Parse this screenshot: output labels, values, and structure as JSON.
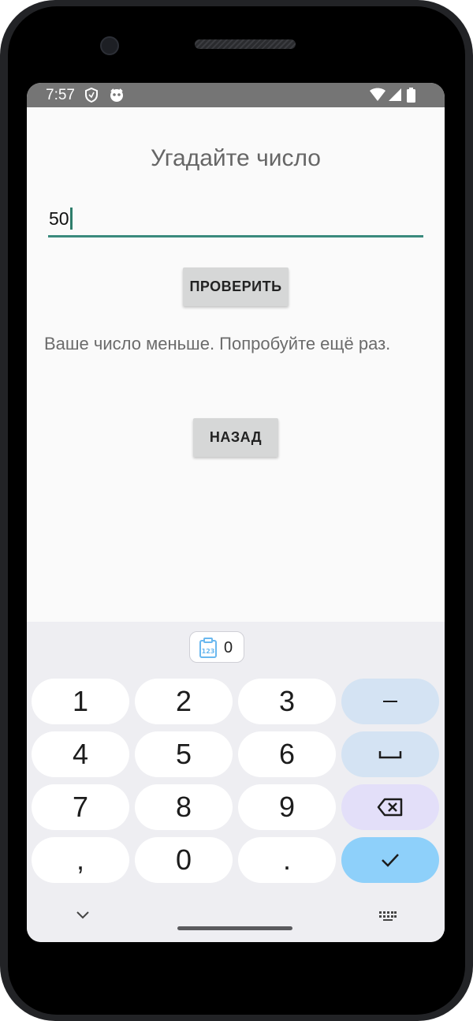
{
  "status_bar": {
    "time": "7:57",
    "icons": [
      "shield-icon",
      "assistant-icon",
      "wifi-icon",
      "signal-icon",
      "battery-icon"
    ]
  },
  "app": {
    "title": "Угадайте число",
    "input_value": "50",
    "check_button_label": "ПРОВЕРИТЬ",
    "message": "Ваше число меньше. Попробуйте ещё раз.",
    "back_button_label": "НАЗАД"
  },
  "keyboard": {
    "clipboard_chip": {
      "icon": "clipboard-numbers-icon",
      "label": "0"
    },
    "digit_keys": [
      "1",
      "2",
      "3",
      "4",
      "5",
      "6",
      "7",
      "8",
      "9",
      ",",
      "0",
      "."
    ],
    "side_keys": [
      "minus",
      "space",
      "backspace",
      "done"
    ],
    "bottom_icons": [
      "chevron-down-icon",
      "keyboard-icon"
    ]
  },
  "colors": {
    "accent": "#3a8a7d",
    "status_bar": "#757575",
    "button_bg": "#d6d7d7",
    "enter_key": "#8ed0fa",
    "side_key": "#d4e3f3",
    "backspace_key": "#e3dff9"
  }
}
